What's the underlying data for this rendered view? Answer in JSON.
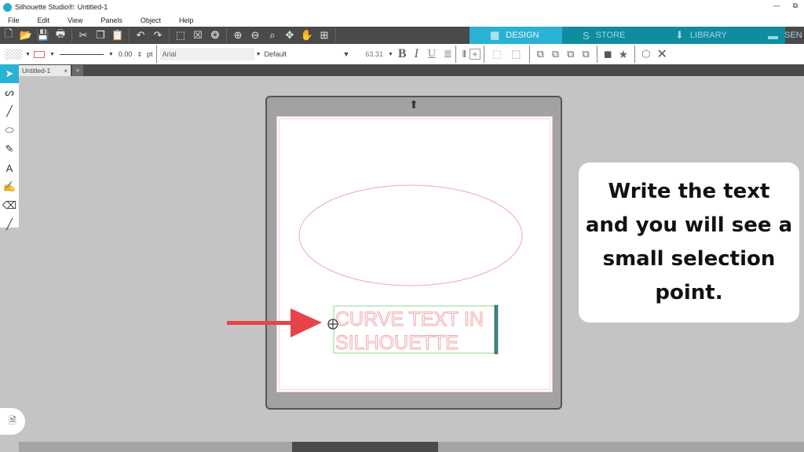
{
  "app": {
    "title": "Silhouette Studio®: Untitled-1",
    "window_buttons": {
      "minimize": "—",
      "restore": "⧉"
    }
  },
  "menu": [
    "File",
    "Edit",
    "View",
    "Panels",
    "Object",
    "Help"
  ],
  "toolbar": {
    "groups": [
      [
        {
          "name": "new-file-icon",
          "glyph": "🗋"
        },
        {
          "name": "open-folder-icon",
          "glyph": "📂"
        },
        {
          "name": "save-icon",
          "glyph": "💾"
        },
        {
          "name": "print-icon",
          "glyph": "🖶"
        }
      ],
      [
        {
          "name": "cut-icon",
          "glyph": "✂"
        },
        {
          "name": "copy-icon",
          "glyph": "❐"
        },
        {
          "name": "paste-icon",
          "glyph": "📋"
        }
      ],
      [
        {
          "name": "undo-icon",
          "glyph": "↶"
        },
        {
          "name": "redo-icon",
          "glyph": "↷"
        }
      ],
      [
        {
          "name": "select-all-icon",
          "glyph": "⬚"
        },
        {
          "name": "deselect-icon",
          "glyph": "☒"
        },
        {
          "name": "select-by-color-icon",
          "glyph": "❂"
        }
      ],
      [
        {
          "name": "zoom-in-icon",
          "glyph": "⊕"
        },
        {
          "name": "zoom-out-icon",
          "glyph": "⊖"
        },
        {
          "name": "zoom-selection-icon",
          "glyph": "⌕"
        },
        {
          "name": "move-icon",
          "glyph": "✥"
        },
        {
          "name": "pan-hand-icon",
          "glyph": "✋"
        },
        {
          "name": "fit-page-icon",
          "glyph": "⊞"
        }
      ]
    ]
  },
  "nav_tabs": [
    {
      "label": "DESIGN",
      "icon": "grid-icon",
      "glyph": "▦",
      "active": true
    },
    {
      "label": "STORE",
      "icon": "store-s-icon",
      "glyph": "S",
      "active": false
    },
    {
      "label": "LIBRARY",
      "icon": "library-download-icon",
      "glyph": "⬇",
      "active": false
    },
    {
      "label": "SEN",
      "icon": "cutter-icon",
      "glyph": "▬",
      "active": false
    }
  ],
  "properties_bar": {
    "line_width": "0.00",
    "line_unit": "pt",
    "font": "Arial",
    "font_style": "Default",
    "font_size": "63.31",
    "bold": "B",
    "italic": "I",
    "underline": "U"
  },
  "document_tabs": [
    {
      "label": "Untitled-1",
      "close": "×"
    }
  ],
  "add_tab": "+",
  "left_tools": [
    {
      "name": "select-tool",
      "icon": "arrow-pointer-icon",
      "glyph": "➤",
      "active": true
    },
    {
      "name": "point-edit-tool",
      "icon": "bezier-icon",
      "glyph": "ᔕ",
      "active": false
    },
    {
      "name": "line-tool",
      "icon": "line-icon",
      "glyph": "╱",
      "active": false
    },
    {
      "name": "ellipse-tool",
      "icon": "ellipse-icon",
      "glyph": "⬭",
      "active": false
    },
    {
      "name": "pencil-tool",
      "icon": "pencil-icon",
      "glyph": "✎",
      "active": false
    },
    {
      "name": "text-tool",
      "icon": "text-a-icon",
      "glyph": "A",
      "active": false
    },
    {
      "name": "fill-tool",
      "icon": "fill-bucket-icon",
      "glyph": "✍",
      "active": false
    },
    {
      "name": "eraser-tool",
      "icon": "eraser-icon",
      "glyph": "⌫",
      "active": false
    },
    {
      "name": "knife-tool",
      "icon": "knife-icon",
      "glyph": "╱",
      "active": false
    }
  ],
  "canvas": {
    "text_lines": [
      "CURVE TEXT IN",
      "SILHOUETTE"
    ],
    "text_color": "#f0a8ae",
    "selection_color": "#9ee29e",
    "ellipse_color": "#f0a8ae",
    "arrow_color": "#e8434a"
  },
  "callout": {
    "text": "Write the text and you will see a small selection point."
  }
}
